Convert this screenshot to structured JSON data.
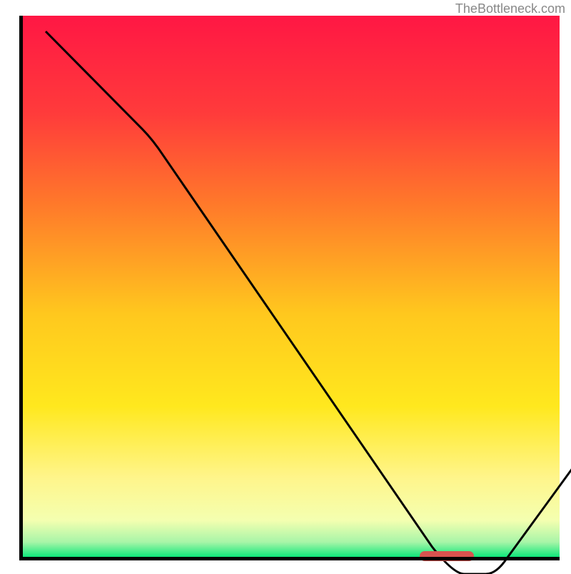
{
  "watermark": "TheBottleneck.com",
  "chart_data": {
    "type": "line",
    "title": "",
    "xlabel": "",
    "ylabel": "",
    "xlim": [
      0,
      100
    ],
    "ylim": [
      0,
      100
    ],
    "x": [
      0,
      20,
      76,
      84,
      100
    ],
    "values": [
      100,
      80,
      0,
      0,
      22
    ],
    "marker_x_range": [
      74,
      84
    ],
    "gradient_stops": [
      {
        "offset": 0,
        "color": "#ff1744"
      },
      {
        "offset": 18,
        "color": "#ff3b3b"
      },
      {
        "offset": 35,
        "color": "#ff7a2a"
      },
      {
        "offset": 55,
        "color": "#ffc81e"
      },
      {
        "offset": 72,
        "color": "#ffe81e"
      },
      {
        "offset": 85,
        "color": "#fff58a"
      },
      {
        "offset": 93,
        "color": "#f4ffb0"
      },
      {
        "offset": 97,
        "color": "#a8f5a8"
      },
      {
        "offset": 100,
        "color": "#00e676"
      }
    ]
  }
}
